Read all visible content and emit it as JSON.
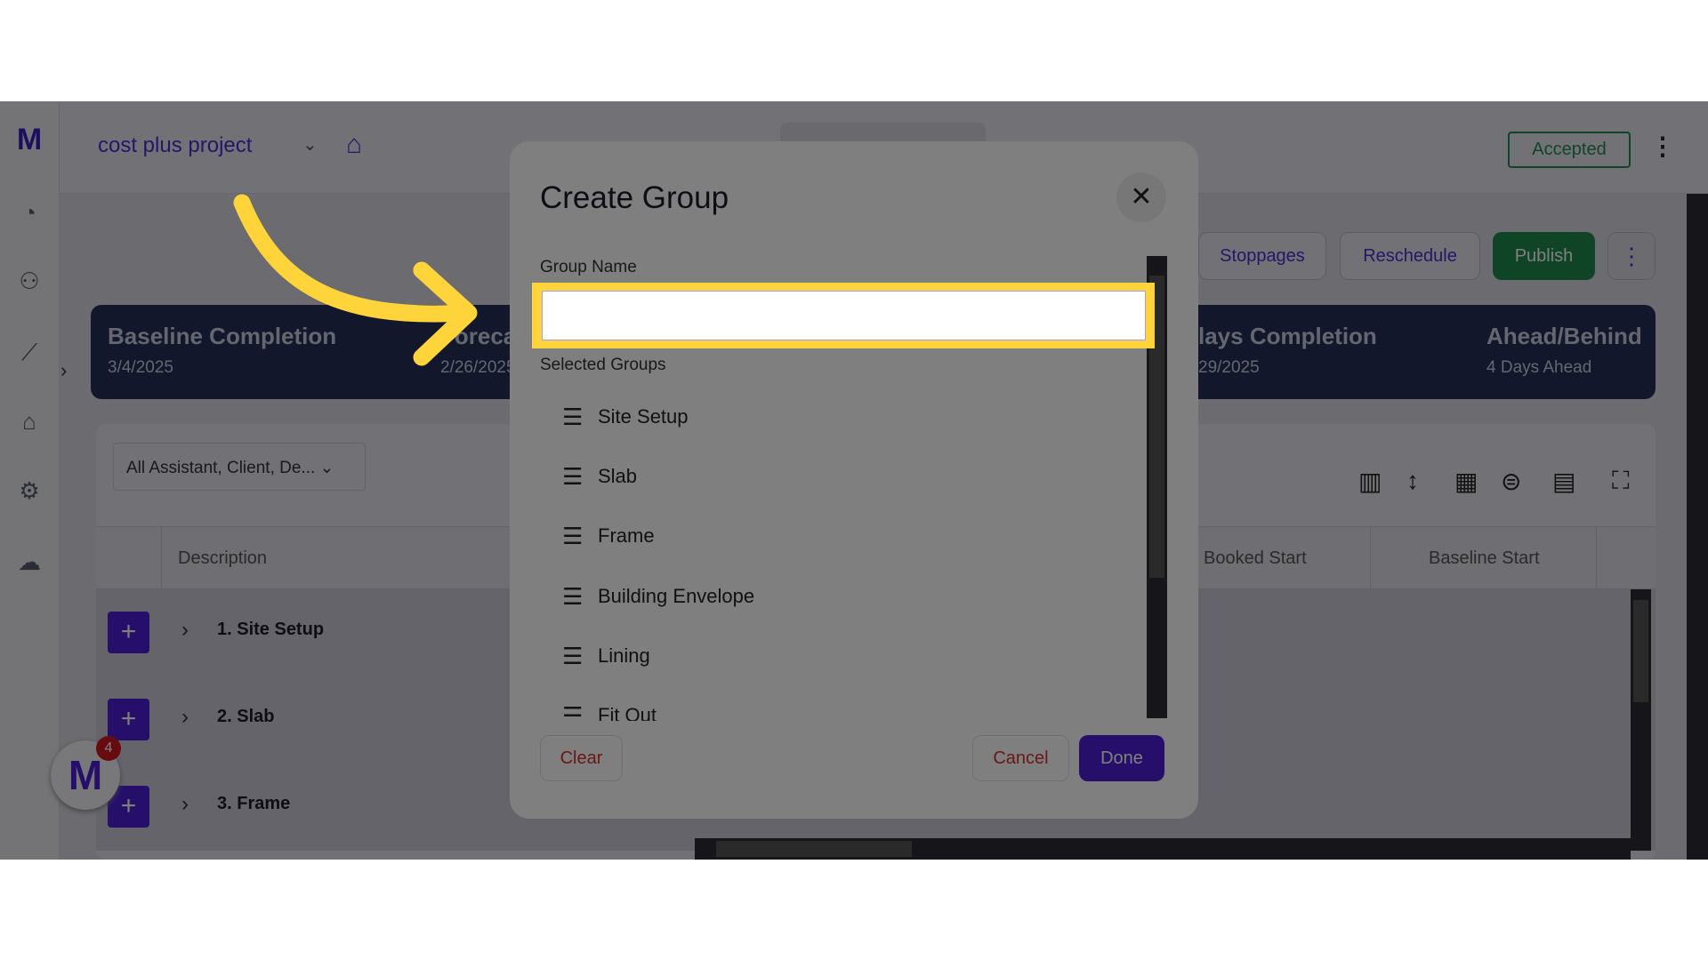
{
  "header": {
    "project": "cost plus project",
    "status": "Accepted"
  },
  "actions": {
    "stoppages": "Stoppages",
    "reschedule": "Reschedule",
    "publish": "Publish"
  },
  "summary": [
    {
      "title": "Baseline Completion",
      "value": "3/4/2025"
    },
    {
      "title": "Forecast Completion",
      "value": "2/26/2025"
    },
    {
      "title": "lays Completion",
      "value": "29/2025"
    },
    {
      "title": "Ahead/Behind",
      "value": "4 Days Ahead"
    }
  ],
  "filter": {
    "value": "All Assistant, Client, De..."
  },
  "table": {
    "columns": [
      "Description",
      "Booked Start",
      "Baseline Start"
    ],
    "rows": [
      "1. Site Setup",
      "2. Slab",
      "3. Frame"
    ]
  },
  "chat": {
    "badge": "4"
  },
  "modal": {
    "title": "Create Group",
    "group_name_label": "Group Name",
    "group_name_value": "",
    "selected_groups_label": "Selected Groups",
    "groups": [
      "Site Setup",
      "Slab",
      "Frame",
      "Building Envelope",
      "Lining",
      "Fit Out"
    ],
    "clear": "Clear",
    "cancel": "Cancel",
    "done": "Done"
  },
  "colors": {
    "accent": "#4a1fd6",
    "publish": "#1e8a4c",
    "highlight": "#ffd43b"
  }
}
